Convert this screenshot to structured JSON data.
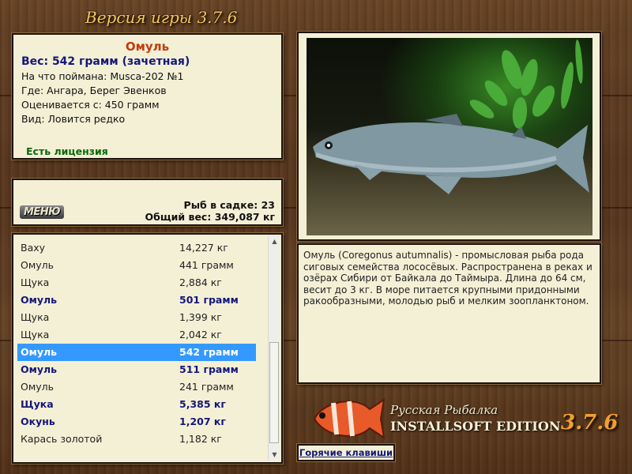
{
  "header": {
    "game_version": "Версия игры 3.7.6"
  },
  "fish_info": {
    "name": "Омуль",
    "weight": "Вес: 542 грамм (зачетная)",
    "bait": "На что поймана: Musca-202 №1",
    "location": "Где: Ангара, Берег Эвенков",
    "valued_from": "Оценивается с: 450 грамм",
    "rarity": "Вид: Ловится редко",
    "license": "Есть лицензия"
  },
  "summary": {
    "menu_label": "МЕНЮ",
    "fish_count": "Рыб в садке: 23",
    "total_weight": "Общий вес: 349,087 кг"
  },
  "catch_list": [
    {
      "name": "Ваху",
      "weight": "14,227 кг",
      "bold": false,
      "selected": false
    },
    {
      "name": "Омуль",
      "weight": "441 грамм",
      "bold": false,
      "selected": false
    },
    {
      "name": "Щука",
      "weight": "2,884 кг",
      "bold": false,
      "selected": false
    },
    {
      "name": "Омуль",
      "weight": "501 грамм",
      "bold": true,
      "selected": false
    },
    {
      "name": "Щука",
      "weight": "1,399 кг",
      "bold": false,
      "selected": false
    },
    {
      "name": "Щука",
      "weight": "2,042 кг",
      "bold": false,
      "selected": false
    },
    {
      "name": "Омуль",
      "weight": "542 грамм",
      "bold": true,
      "selected": true
    },
    {
      "name": "Омуль",
      "weight": "511 грамм",
      "bold": true,
      "selected": false
    },
    {
      "name": "Омуль",
      "weight": "241 грамм",
      "bold": false,
      "selected": false
    },
    {
      "name": "Щука",
      "weight": "5,385 кг",
      "bold": true,
      "selected": false
    },
    {
      "name": "Окунь",
      "weight": "1,207 кг",
      "bold": true,
      "selected": false
    },
    {
      "name": "Карась золотой",
      "weight": "1,182 кг",
      "bold": false,
      "selected": false
    }
  ],
  "description": "Омуль (Coregonus autumnalis) - промысловая рыба рода сиговых семейства лососёвых. Распространена в реках и озёрах Сибири от Байкала до Таймыра. Длина до 64 см, весит до 3 кг. В море питается крупными придонными ракообразными, молодью рыб и мелким зоопланктоном.",
  "brand": {
    "line1": "Русская Рыбалка",
    "line2": "INSTALLSOFT EDITION",
    "version": "3.7.6"
  },
  "hotkeys_label": "Горячие клавиши",
  "colors": {
    "accent_name": "#c23a0a",
    "bold_blue": "#14177a",
    "license_green": "#0a6a0a",
    "selection": "#3399ff",
    "panel_bg": "#f4f0d6"
  }
}
